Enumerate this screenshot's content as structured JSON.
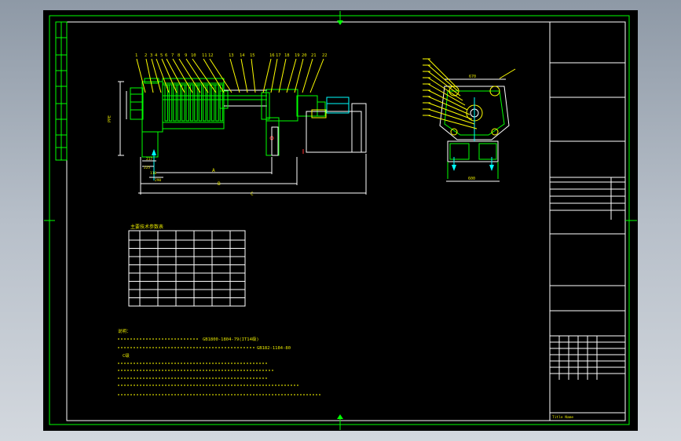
{
  "colors": {
    "background": "#000000",
    "frame": "#00ff00",
    "text": "#ffff00",
    "dimension": "#ffffff",
    "accent": "#00ffff",
    "workspace": "#a9b2bd"
  },
  "front_view": {
    "balloons": [
      "1",
      "2",
      "3",
      "4",
      "5",
      "6",
      "7",
      "8",
      "9",
      "10",
      "11",
      "12",
      "13",
      "14",
      "15",
      "16",
      "17",
      "18",
      "19",
      "20",
      "21",
      "22"
    ],
    "dimensions": {
      "a": "A",
      "b": "B",
      "c": "C",
      "d217": "217",
      "d225": "225",
      "d110": "110",
      "d290": "290",
      "left_vertical": "PPE"
    }
  },
  "side_view": {
    "top_width": "670",
    "bottom_width": "600"
  },
  "param_table": {
    "title": "主要技术参数表"
  },
  "notes": {
    "heading": "说明：",
    "line1_tail": "GB1800-1804-79(IT14级)",
    "line2_tail": "GB182-1184-80",
    "line_c": "C级"
  },
  "title_block": {
    "bottom_left": "Title  Name"
  }
}
